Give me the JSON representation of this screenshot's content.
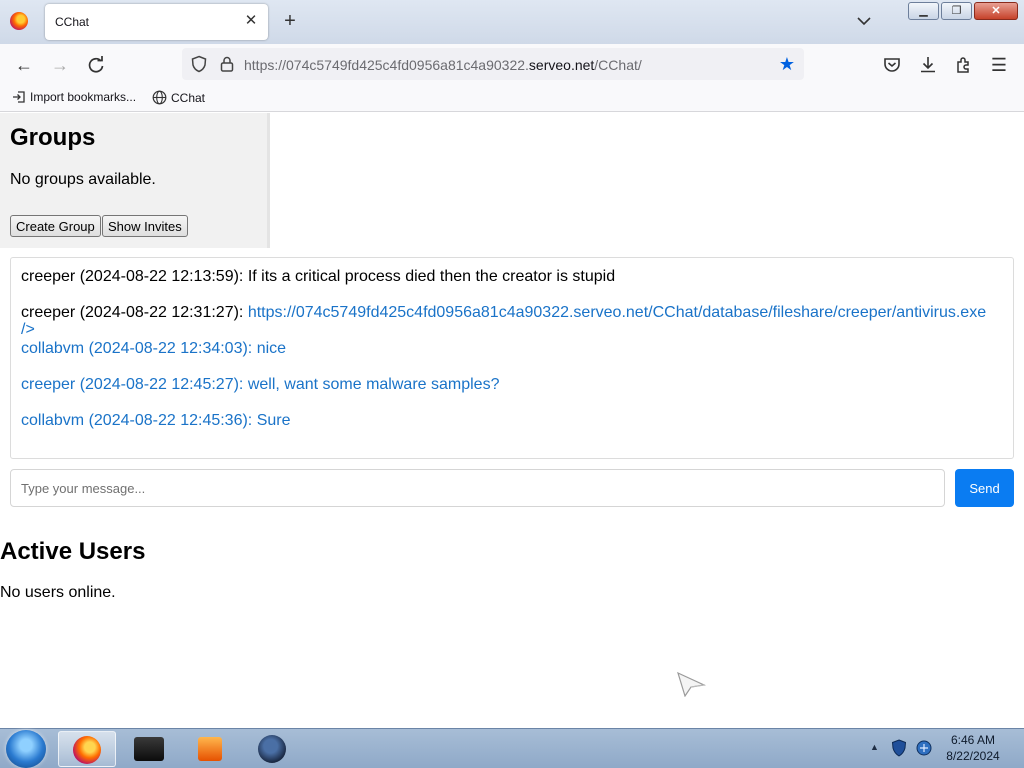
{
  "browser": {
    "tab_title": "CChat",
    "tab_close": "✕",
    "new_tab": "+",
    "url_prefix": "https://074c5749fd425c4fd0956a81c4a90322.",
    "url_host": "serveo.net",
    "url_path": "/CChat/",
    "bookmarks": [
      {
        "label": "Import bookmarks...",
        "icon": "import-icon"
      },
      {
        "label": "CChat",
        "icon": "globe-icon"
      }
    ]
  },
  "groups": {
    "title": "Groups",
    "empty_text": "No groups available.",
    "create_button": "Create Group",
    "invites_button": "Show Invites"
  },
  "chat": {
    "messages": [
      {
        "prefix": "creeper (2024-08-22 12:13:59): If its a critical process died then the creator is stupid"
      },
      {
        "prefix": "creeper (2024-08-22 12:31:27): ",
        "link": "https://074c5749fd425c4fd0956a81c4a90322.serveo.net/CChat/database/fileshare/creeper/antivirus.exe"
      },
      {
        "prefix": "/>"
      },
      {
        "prefix": "collabvm (2024-08-22 12:34:03): nice"
      },
      {
        "prefix": "creeper (2024-08-22 12:45:27): well, want some malware samples?"
      },
      {
        "prefix": "collabvm (2024-08-22 12:45:36): Sure"
      }
    ],
    "input_placeholder": "Type your message...",
    "send_button": "Send",
    "accent_color": "#0a7cf2",
    "link_color": "#1a73c8"
  },
  "users": {
    "title": "Active Users",
    "empty_text": "No users online."
  },
  "taskbar": {
    "items": [
      "firefox-icon",
      "terminal-icon",
      "media-player-icon",
      "globe-app-icon"
    ],
    "time": "6:46 AM",
    "date": "8/22/2024"
  }
}
